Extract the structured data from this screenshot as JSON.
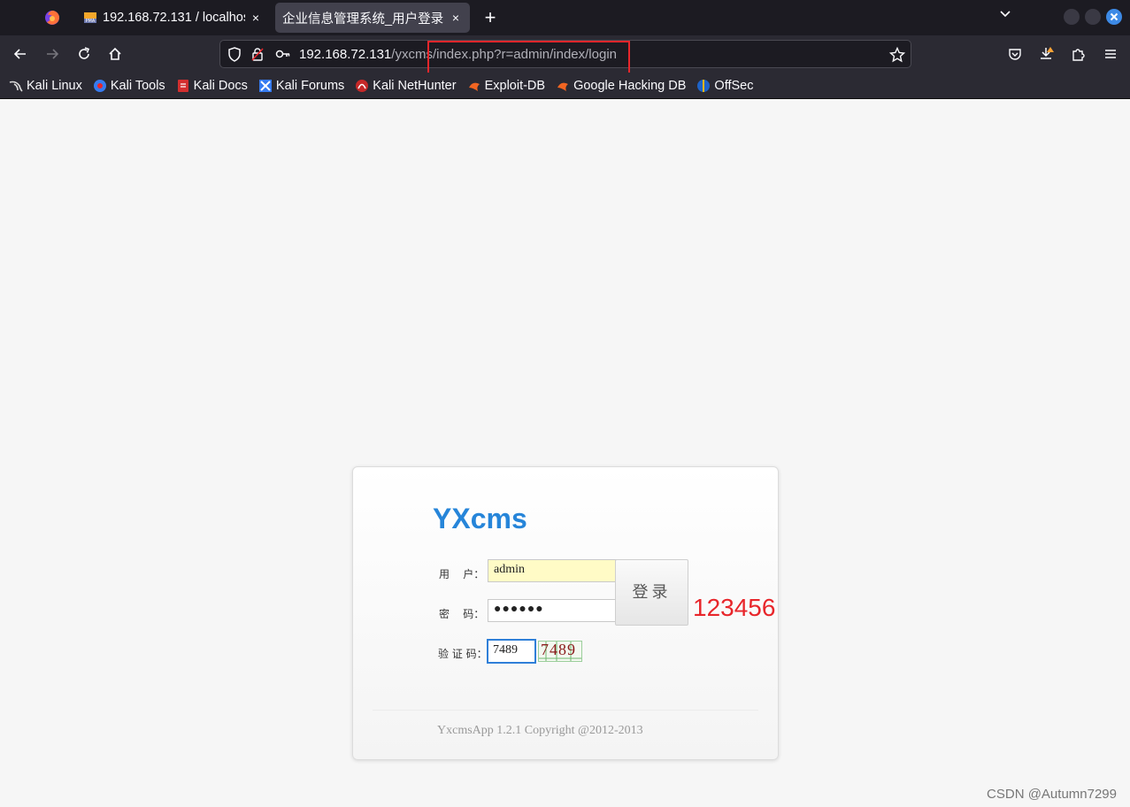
{
  "browser": {
    "tabs": [
      {
        "title": "192.168.72.131 / localhost",
        "close": "×",
        "active": false
      },
      {
        "title": "企业信息管理系统_用户登录",
        "close": "×",
        "active": true
      }
    ],
    "new_tab": "+",
    "url_host": "192.168.72.131",
    "url_path": "/yxcms/index.php?r=admin/index/login",
    "bookmarks": [
      {
        "label": "Kali Linux",
        "icon": "kali-dragon-icon"
      },
      {
        "label": "Kali Tools",
        "icon": "kali-tools-icon"
      },
      {
        "label": "Kali Docs",
        "icon": "kali-docs-icon"
      },
      {
        "label": "Kali Forums",
        "icon": "kali-forums-icon"
      },
      {
        "label": "Kali NetHunter",
        "icon": "nethunter-icon"
      },
      {
        "label": "Exploit-DB",
        "icon": "exploit-db-icon"
      },
      {
        "label": "Google Hacking DB",
        "icon": "ghdb-icon"
      },
      {
        "label": "OffSec",
        "icon": "offsec-icon"
      }
    ]
  },
  "login": {
    "logo": "YXcms",
    "user_label": "用    户：",
    "user_value": "admin",
    "password_label": "密    码：",
    "password_value": "●●●●●●",
    "captcha_label": "验 证 码：",
    "captcha_value": "7489",
    "captcha_image_text": "7489",
    "login_button": "登录",
    "copyright": "YxcmsApp 1.2.1 Copyright @2012-2013"
  },
  "annotation": {
    "password_note": "123456",
    "note_color": "#e8262b"
  },
  "watermark": "CSDN @Autumn7299",
  "colors": {
    "logo": "#2685d9",
    "accent": "#3d8ae6"
  }
}
